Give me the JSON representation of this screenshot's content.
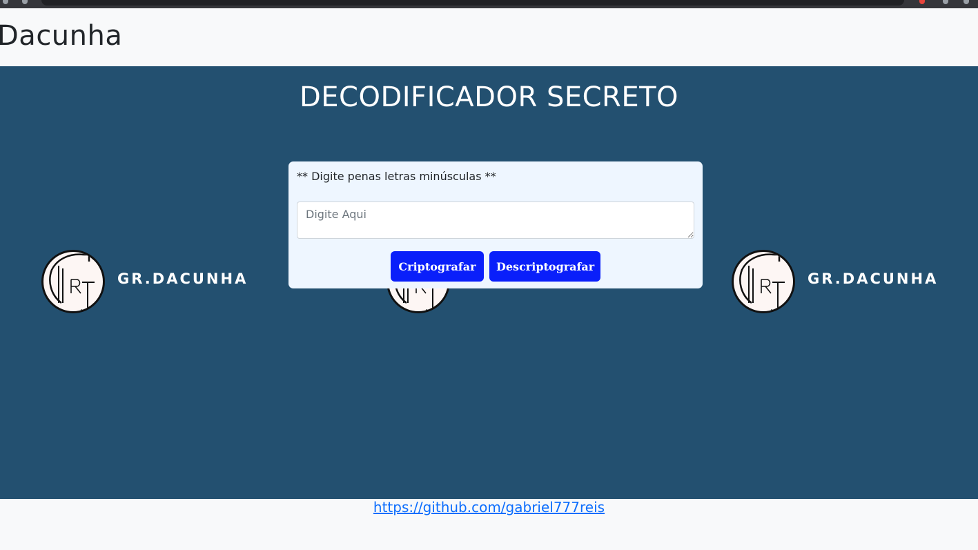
{
  "header": {
    "brand": "Dacunha"
  },
  "hero": {
    "title": "DECODIFICADOR SECRETO",
    "background": "#235070",
    "logo_text": "GR.DACUNHA"
  },
  "form": {
    "hint": "** Digite penas letras minúsculas **",
    "input_value": "",
    "input_placeholder": "Digite Aqui",
    "encrypt_label": "Criptografar",
    "decrypt_label": "Descriptografar",
    "button_color": "#0a1ffa"
  },
  "footer": {
    "link_text": "https://github.com/gabriel777reis"
  }
}
